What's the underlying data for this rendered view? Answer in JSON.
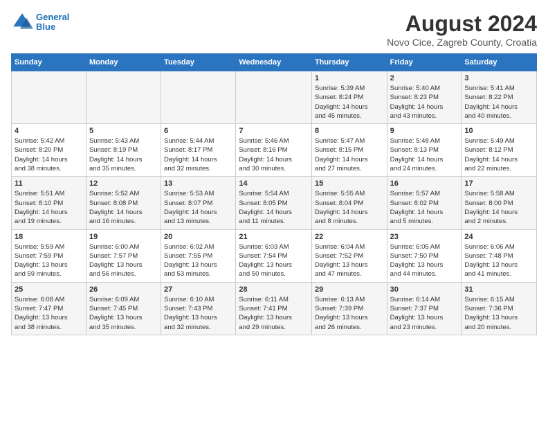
{
  "header": {
    "logo_line1": "General",
    "logo_line2": "Blue",
    "month_year": "August 2024",
    "location": "Novo Cice, Zagreb County, Croatia"
  },
  "days_of_week": [
    "Sunday",
    "Monday",
    "Tuesday",
    "Wednesday",
    "Thursday",
    "Friday",
    "Saturday"
  ],
  "weeks": [
    [
      {
        "day": "",
        "info": ""
      },
      {
        "day": "",
        "info": ""
      },
      {
        "day": "",
        "info": ""
      },
      {
        "day": "",
        "info": ""
      },
      {
        "day": "1",
        "info": "Sunrise: 5:39 AM\nSunset: 8:24 PM\nDaylight: 14 hours\nand 45 minutes."
      },
      {
        "day": "2",
        "info": "Sunrise: 5:40 AM\nSunset: 8:23 PM\nDaylight: 14 hours\nand 43 minutes."
      },
      {
        "day": "3",
        "info": "Sunrise: 5:41 AM\nSunset: 8:22 PM\nDaylight: 14 hours\nand 40 minutes."
      }
    ],
    [
      {
        "day": "4",
        "info": "Sunrise: 5:42 AM\nSunset: 8:20 PM\nDaylight: 14 hours\nand 38 minutes."
      },
      {
        "day": "5",
        "info": "Sunrise: 5:43 AM\nSunset: 8:19 PM\nDaylight: 14 hours\nand 35 minutes."
      },
      {
        "day": "6",
        "info": "Sunrise: 5:44 AM\nSunset: 8:17 PM\nDaylight: 14 hours\nand 32 minutes."
      },
      {
        "day": "7",
        "info": "Sunrise: 5:46 AM\nSunset: 8:16 PM\nDaylight: 14 hours\nand 30 minutes."
      },
      {
        "day": "8",
        "info": "Sunrise: 5:47 AM\nSunset: 8:15 PM\nDaylight: 14 hours\nand 27 minutes."
      },
      {
        "day": "9",
        "info": "Sunrise: 5:48 AM\nSunset: 8:13 PM\nDaylight: 14 hours\nand 24 minutes."
      },
      {
        "day": "10",
        "info": "Sunrise: 5:49 AM\nSunset: 8:12 PM\nDaylight: 14 hours\nand 22 minutes."
      }
    ],
    [
      {
        "day": "11",
        "info": "Sunrise: 5:51 AM\nSunset: 8:10 PM\nDaylight: 14 hours\nand 19 minutes."
      },
      {
        "day": "12",
        "info": "Sunrise: 5:52 AM\nSunset: 8:08 PM\nDaylight: 14 hours\nand 16 minutes."
      },
      {
        "day": "13",
        "info": "Sunrise: 5:53 AM\nSunset: 8:07 PM\nDaylight: 14 hours\nand 13 minutes."
      },
      {
        "day": "14",
        "info": "Sunrise: 5:54 AM\nSunset: 8:05 PM\nDaylight: 14 hours\nand 11 minutes."
      },
      {
        "day": "15",
        "info": "Sunrise: 5:55 AM\nSunset: 8:04 PM\nDaylight: 14 hours\nand 8 minutes."
      },
      {
        "day": "16",
        "info": "Sunrise: 5:57 AM\nSunset: 8:02 PM\nDaylight: 14 hours\nand 5 minutes."
      },
      {
        "day": "17",
        "info": "Sunrise: 5:58 AM\nSunset: 8:00 PM\nDaylight: 14 hours\nand 2 minutes."
      }
    ],
    [
      {
        "day": "18",
        "info": "Sunrise: 5:59 AM\nSunset: 7:59 PM\nDaylight: 13 hours\nand 59 minutes."
      },
      {
        "day": "19",
        "info": "Sunrise: 6:00 AM\nSunset: 7:57 PM\nDaylight: 13 hours\nand 56 minutes."
      },
      {
        "day": "20",
        "info": "Sunrise: 6:02 AM\nSunset: 7:55 PM\nDaylight: 13 hours\nand 53 minutes."
      },
      {
        "day": "21",
        "info": "Sunrise: 6:03 AM\nSunset: 7:54 PM\nDaylight: 13 hours\nand 50 minutes."
      },
      {
        "day": "22",
        "info": "Sunrise: 6:04 AM\nSunset: 7:52 PM\nDaylight: 13 hours\nand 47 minutes."
      },
      {
        "day": "23",
        "info": "Sunrise: 6:05 AM\nSunset: 7:50 PM\nDaylight: 13 hours\nand 44 minutes."
      },
      {
        "day": "24",
        "info": "Sunrise: 6:06 AM\nSunset: 7:48 PM\nDaylight: 13 hours\nand 41 minutes."
      }
    ],
    [
      {
        "day": "25",
        "info": "Sunrise: 6:08 AM\nSunset: 7:47 PM\nDaylight: 13 hours\nand 38 minutes."
      },
      {
        "day": "26",
        "info": "Sunrise: 6:09 AM\nSunset: 7:45 PM\nDaylight: 13 hours\nand 35 minutes."
      },
      {
        "day": "27",
        "info": "Sunrise: 6:10 AM\nSunset: 7:43 PM\nDaylight: 13 hours\nand 32 minutes."
      },
      {
        "day": "28",
        "info": "Sunrise: 6:11 AM\nSunset: 7:41 PM\nDaylight: 13 hours\nand 29 minutes."
      },
      {
        "day": "29",
        "info": "Sunrise: 6:13 AM\nSunset: 7:39 PM\nDaylight: 13 hours\nand 26 minutes."
      },
      {
        "day": "30",
        "info": "Sunrise: 6:14 AM\nSunset: 7:37 PM\nDaylight: 13 hours\nand 23 minutes."
      },
      {
        "day": "31",
        "info": "Sunrise: 6:15 AM\nSunset: 7:36 PM\nDaylight: 13 hours\nand 20 minutes."
      }
    ]
  ]
}
